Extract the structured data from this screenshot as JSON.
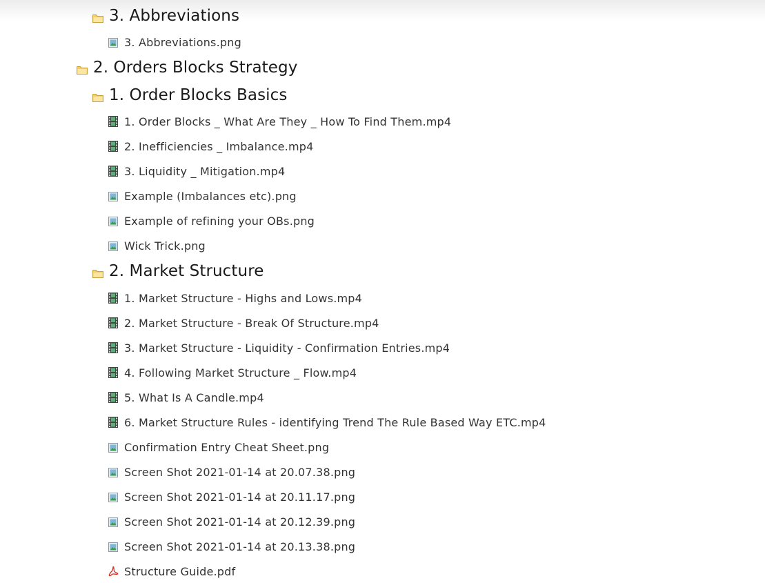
{
  "items": [
    {
      "type": "folder",
      "label": "3. Abbreviations"
    },
    {
      "type": "image",
      "label": "3. Abbreviations.png"
    },
    {
      "type": "folder",
      "label": "2. Orders Blocks Strategy"
    },
    {
      "type": "folder",
      "label": "1. Order Blocks Basics"
    },
    {
      "type": "video",
      "label": "1. Order Blocks _ What Are They _ How To Find Them.mp4"
    },
    {
      "type": "video",
      "label": "2. Inefficiencies _ Imbalance.mp4"
    },
    {
      "type": "video",
      "label": "3. Liquidity _ Mitigation.mp4"
    },
    {
      "type": "image",
      "label": "Example (Imbalances etc).png"
    },
    {
      "type": "image",
      "label": "Example of refining your OBs.png"
    },
    {
      "type": "image",
      "label": "Wick Trick.png"
    },
    {
      "type": "folder",
      "label": "2. Market Structure"
    },
    {
      "type": "video",
      "label": "1. Market Structure - Highs and Lows.mp4"
    },
    {
      "type": "video",
      "label": "2. Market Structure - Break Of Structure.mp4"
    },
    {
      "type": "video",
      "label": "3. Market Structure - Liquidity - Confirmation Entries.mp4"
    },
    {
      "type": "video",
      "label": "4. Following Market Structure _ Flow.mp4"
    },
    {
      "type": "video",
      "label": "5. What Is A Candle.mp4"
    },
    {
      "type": "video",
      "label": "6. Market Structure Rules - identifying Trend The Rule Based Way ETC.mp4"
    },
    {
      "type": "image",
      "label": "Confirmation Entry Cheat Sheet.png"
    },
    {
      "type": "image",
      "label": "Screen Shot 2021-01-14 at 20.07.38.png"
    },
    {
      "type": "image",
      "label": "Screen Shot 2021-01-14 at 20.11.17.png"
    },
    {
      "type": "image",
      "label": "Screen Shot 2021-01-14 at 20.12.39.png"
    },
    {
      "type": "image",
      "label": "Screen Shot 2021-01-14 at 20.13.38.png"
    },
    {
      "type": "pdf",
      "label": "Structure Guide.pdf"
    }
  ],
  "icons": {
    "folder": "folder-icon",
    "image": "image-file-icon",
    "video": "film-icon",
    "pdf": "pdf-icon"
  },
  "colors": {
    "folder": "#f2cf6b",
    "image_frame": "#8a9aa6",
    "image_fill": "#3f9a55",
    "film": "#3f4a45",
    "pdf": "#d9342b"
  }
}
